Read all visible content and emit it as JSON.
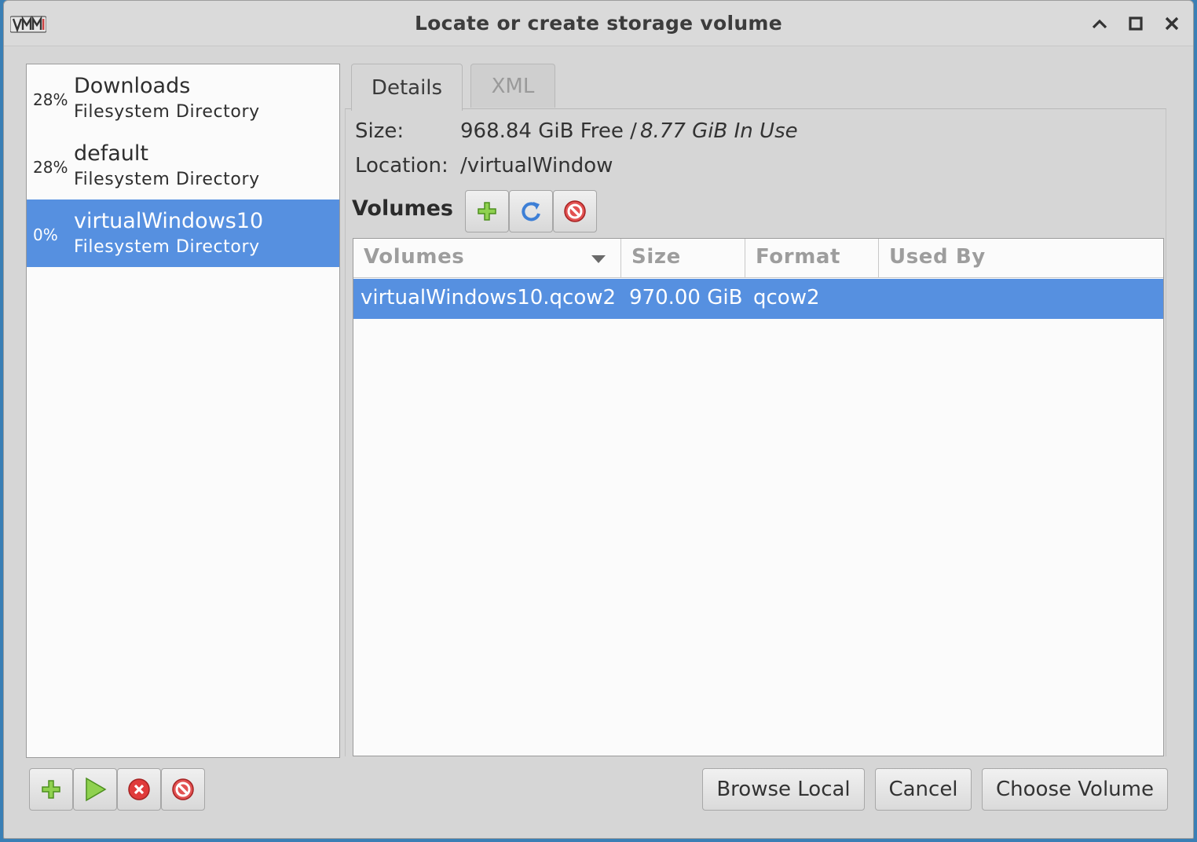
{
  "window": {
    "title": "Locate or create storage volume"
  },
  "pools": [
    {
      "percent": "28%",
      "name": "Downloads",
      "type": "Filesystem Directory",
      "selected": false
    },
    {
      "percent": "28%",
      "name": "default",
      "type": "Filesystem Directory",
      "selected": false
    },
    {
      "percent": "0%",
      "name": "virtualWindows10",
      "type": "Filesystem Directory",
      "selected": true
    }
  ],
  "tabs": {
    "details": "Details",
    "xml": "XML"
  },
  "details": {
    "size_label": "Size:",
    "size_free": "968.84 GiB Free /",
    "size_in_use": "8.77 GiB In Use",
    "location_label": "Location:",
    "location_value": "/virtualWindow"
  },
  "volumes_section": {
    "heading": "Volumes"
  },
  "volume_table": {
    "columns": [
      "Volumes",
      "Size",
      "Format",
      "Used By"
    ],
    "rows": [
      {
        "name": "virtualWindows10.qcow2",
        "size": "970.00 GiB",
        "format": "qcow2",
        "used_by": "",
        "selected": true
      }
    ]
  },
  "buttons": {
    "browse_local": "Browse Local",
    "cancel": "Cancel",
    "choose_volume": "Choose Volume"
  },
  "colors": {
    "selection": "#5690e0",
    "add_green": "#6cbf2e",
    "refresh_blue": "#3d7fd6",
    "stop_red": "#d33a3a"
  }
}
